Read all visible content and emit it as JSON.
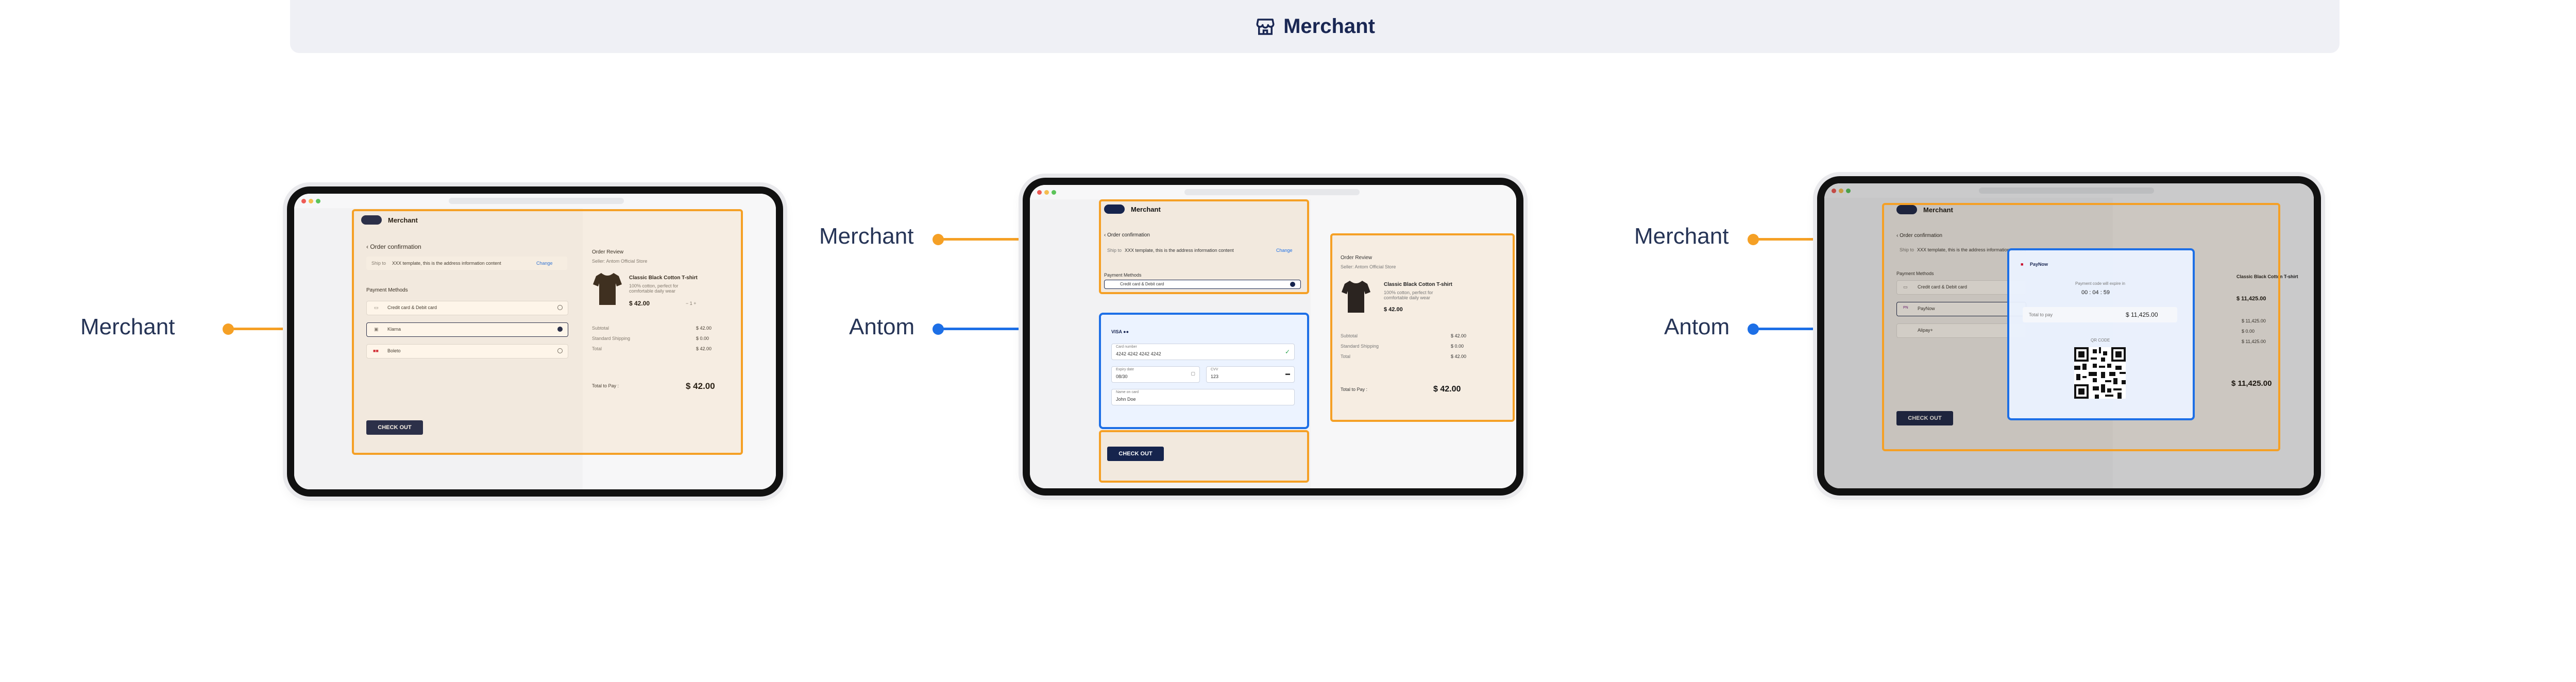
{
  "banner": {
    "icon": "store-icon",
    "title": "Merchant"
  },
  "callouts": {
    "d1_merchant": "Merchant",
    "d2_merchant": "Merchant",
    "d2_antom": "Antom",
    "d3_merchant": "Merchant",
    "d3_antom": "Antom"
  },
  "colors": {
    "merchant": "#f5a025",
    "antom": "#1d6fe6",
    "brand": "#16244d"
  },
  "device1": {
    "app_title": "Merchant",
    "back_label": "Order confirmation",
    "ship_label": "Ship to",
    "ship_text": "XXX template, this is the address information content",
    "change_label": "Change",
    "payment_methods_label": "Payment Methods",
    "methods": [
      "Credit card & Debit card",
      "Klarna",
      "Boleto"
    ],
    "checkout": "CHECK OUT",
    "order_review": "Order Review",
    "seller": "Seller: Antom Official Store",
    "product_name": "Classic Black Cotton T-shirt",
    "product_desc": "100% cotton, perfect for comfortable daily wear",
    "price": "$ 42.00",
    "qty": "1",
    "summary": [
      {
        "label": "Subtotal",
        "value": "$ 42.00"
      },
      {
        "label": "Standard Shipping",
        "value": "$ 0.00"
      },
      {
        "label": "Total",
        "value": "$ 42.00"
      }
    ],
    "total_label": "Total to Pay :",
    "total_value": "$ 42.00"
  },
  "device2": {
    "app_title": "Merchant",
    "back_label": "Order confirmation",
    "ship_label": "Ship to",
    "ship_text": "XXX template, this is the address information content",
    "change_label": "Change",
    "payment_methods_label": "Payment Methods",
    "selected_method": "Credit card & Debit card",
    "card_number_label": "Card number",
    "card_number": "4242 4242 4242 4242",
    "expiry_label": "Expiry date",
    "expiry": "08/30",
    "cvv_label": "CVV",
    "cvv": "123",
    "name_label": "Name on card",
    "name": "John Doe",
    "checkout": "CHECK OUT",
    "order_review": "Order Review",
    "seller": "Seller: Antom Official Store",
    "product_name": "Classic Black Cotton T-shirt",
    "product_desc": "100% cotton, perfect for comfortable daily wear",
    "price": "$ 42.00",
    "summary": [
      {
        "label": "Subtotal",
        "value": "$ 42.00"
      },
      {
        "label": "Standard Shipping",
        "value": "$ 0.00"
      },
      {
        "label": "Total",
        "value": "$ 42.00"
      }
    ],
    "total_label": "Total to Pay :",
    "total_value": "$ 42.00"
  },
  "device3": {
    "app_title": "Merchant",
    "back_label": "Order confirmation",
    "ship_label": "Ship to",
    "ship_text": "XXX template, this is the address information content",
    "payment_methods_label": "Payment Methods",
    "methods": [
      "Credit card & Debit card",
      "PayNow",
      "Alipay+"
    ],
    "checkout": "CHECK OUT",
    "product_name": "Classic Black Cotton T-shirt",
    "product_price": "$ 11,425.00",
    "summary_values": [
      "$ 11,425.00",
      "$ 0.00",
      "$ 11,425.00"
    ],
    "total_value": "$ 11,425.00",
    "popup": {
      "brand": "PayNow",
      "countdown_label": "Payment code will expire in",
      "countdown": "00 : 04 : 59",
      "amount_label": "Total to pay",
      "amount": "$ 11,425.00",
      "qr_label": "QR CODE"
    }
  }
}
